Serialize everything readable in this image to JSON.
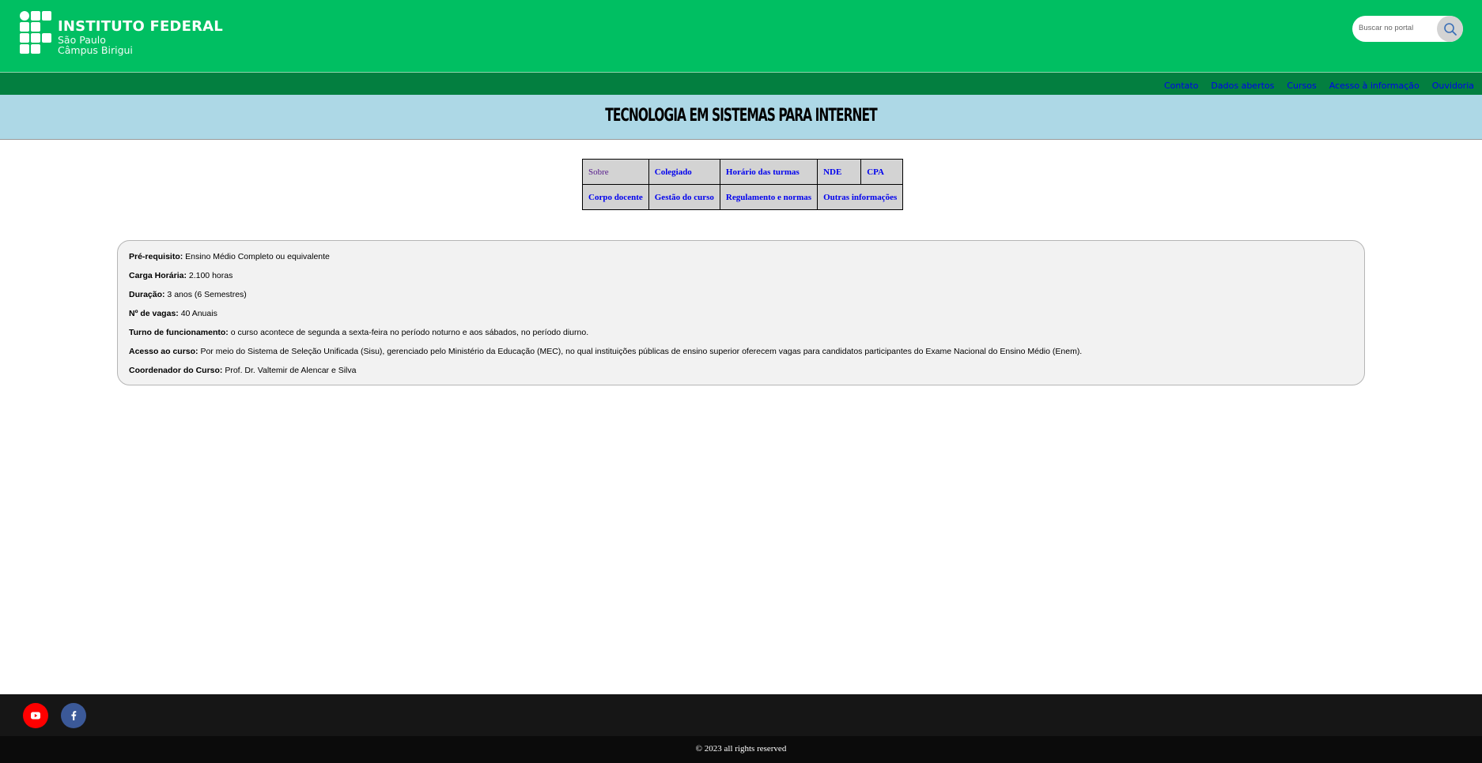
{
  "header": {
    "logo_title": "INSTITUTO FEDERAL",
    "logo_line2": "São Paulo",
    "logo_line3": "Câmpus Birigui",
    "search_placeholder": "Buscar no portal",
    "search_icon": "magnifier-icon"
  },
  "topnav": {
    "items": [
      "Contato",
      "Dados abertos",
      "Cursos",
      "Acesso à informação",
      "Ouvidoria"
    ]
  },
  "page": {
    "title": "TECNOLOGIA EM SISTEMAS PARA INTERNET"
  },
  "course_menu": {
    "row1": [
      "Sobre",
      "Colegiado",
      "Horário das turmas",
      "NDE",
      "CPA"
    ],
    "row2": [
      "Corpo docente",
      "Gestão do curso",
      "Regulamento e normas",
      "Outras informações"
    ]
  },
  "info": [
    {
      "label": "Pré-requisito:",
      "value": " Ensino Médio Completo ou equivalente"
    },
    {
      "label": "Carga Horária:",
      "value": " 2.100 horas"
    },
    {
      "label": "Duração:",
      "value": " 3 anos (6 Semestres)"
    },
    {
      "label": "Nº de vagas:",
      "value": " 40 Anuais"
    },
    {
      "label": "Turno de funcionamento:",
      "value": " o curso acontece de segunda a sexta-feira no período noturno e aos sábados, no período diurno."
    },
    {
      "label": "Acesso ao curso:",
      "value": " Por meio do Sistema de Seleção Unificada (Sisu), gerenciado pelo Ministério da Educação (MEC), no qual instituições públicas de ensino superior oferecem vagas para candidatos participantes do Exame Nacional do Ensino Médio (Enem)."
    },
    {
      "label": "Coordenador do Curso:",
      "value": " Prof. Dr. Valtemir de Alencar e Silva"
    }
  ],
  "footer": {
    "social": [
      "youtube-icon",
      "facebook-icon"
    ],
    "copyright": "© 2023 all rights reserved"
  },
  "colors": {
    "header_green": "#00bf62",
    "nav_green": "#037f40",
    "title_band": "#add8e6",
    "link": "#0000ee"
  }
}
